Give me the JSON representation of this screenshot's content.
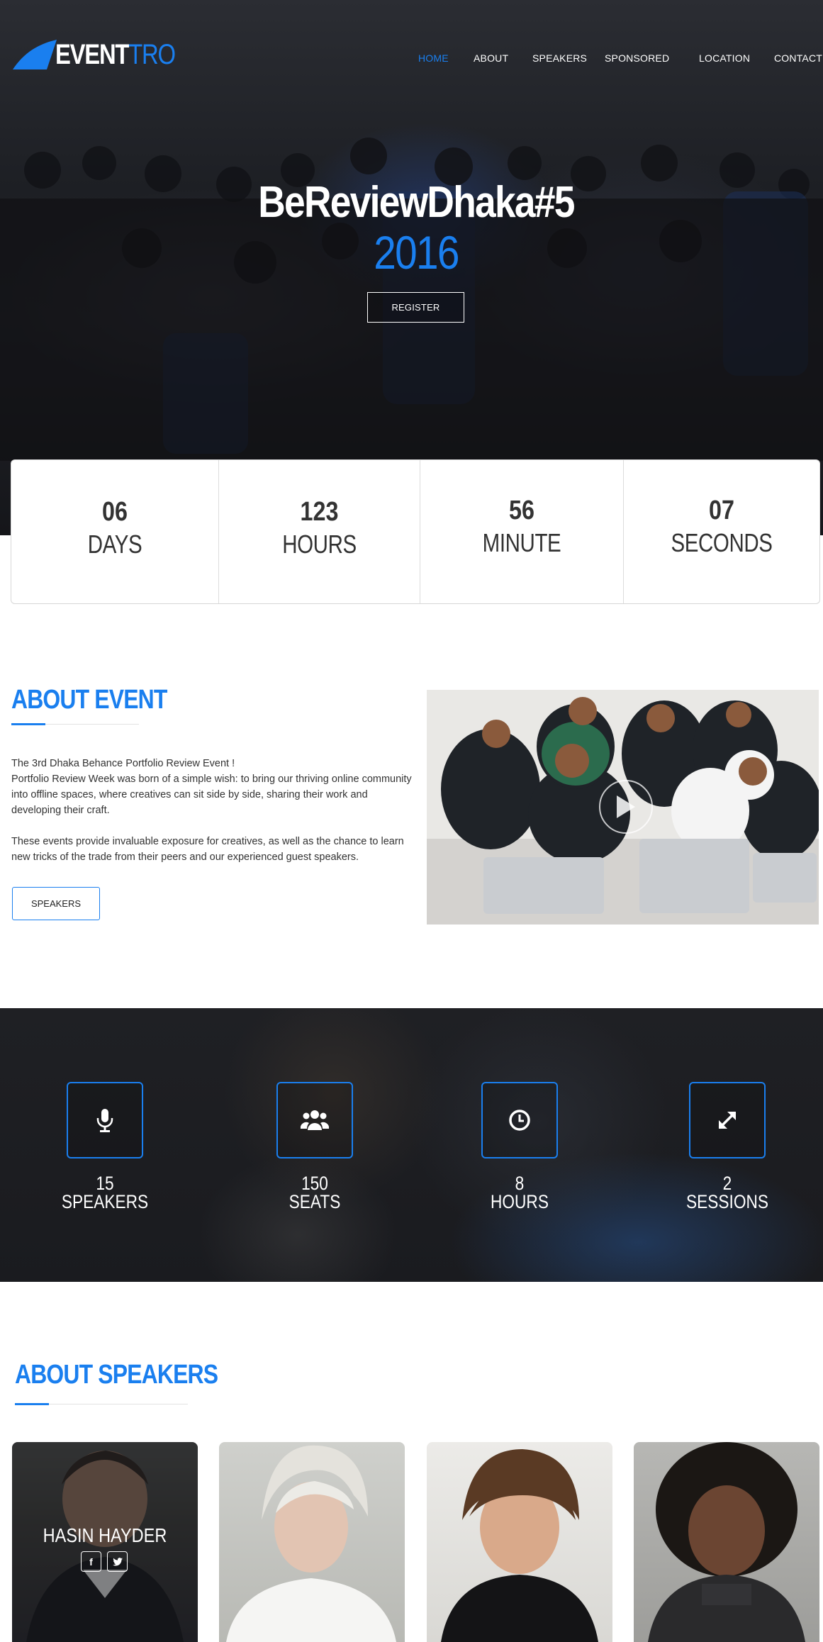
{
  "brand": {
    "name_part1": "EVENT",
    "name_part2": "TRO"
  },
  "nav": {
    "items": [
      {
        "label": "HOME",
        "active": true
      },
      {
        "label": "ABOUT",
        "active": false
      },
      {
        "label": "SPEAKERS",
        "active": false
      },
      {
        "label": "SPONSORED",
        "active": false
      },
      {
        "label": "LOCATION",
        "active": false
      },
      {
        "label": "CONTACT",
        "active": false
      }
    ]
  },
  "hero": {
    "title": "BeReviewDhaka#5",
    "year": "2016",
    "register_label": "REGISTER"
  },
  "countdown": [
    {
      "value": "06",
      "label": "DAYS"
    },
    {
      "value": "123",
      "label": "HOURS"
    },
    {
      "value": "56",
      "label": "MINUTE"
    },
    {
      "value": "07",
      "label": "SECONDS"
    }
  ],
  "about": {
    "title": "ABOUT EVENT",
    "line1": "The 3rd  Dhaka Behance Portfolio Review Event !",
    "para1": "Portfolio Review Week was born of a simple wish: to bring our thriving online community into offline spaces, where creatives can sit side by side, sharing their work and developing their craft.",
    "para2": "These events provide invaluable exposure for creatives, as well as the chance to learn new tricks of the trade from their peers and our experienced guest speakers.",
    "button_label": "SPEAKERS"
  },
  "stats": [
    {
      "icon": "microphone-icon",
      "value": "15",
      "label": "SPEAKERS"
    },
    {
      "icon": "users-icon",
      "value": "150",
      "label": "SEATS"
    },
    {
      "icon": "clock-icon",
      "value": "8",
      "label": "HOURS"
    },
    {
      "icon": "expand-icon",
      "value": "2",
      "label": "SESSIONS"
    }
  ],
  "speakers": {
    "title": "ABOUT SPEAKERS",
    "featured_name": "HASIN HAYDER",
    "social": [
      "f",
      "t"
    ]
  },
  "colors": {
    "accent": "#1a7fef",
    "dark": "#1b1c20"
  }
}
